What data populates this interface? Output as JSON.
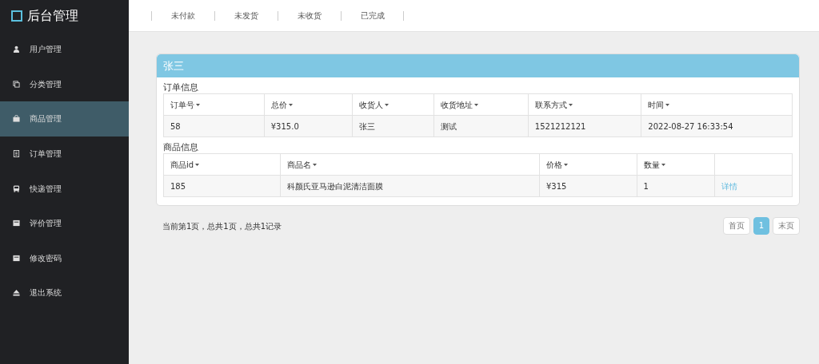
{
  "sidebar": {
    "title": "后台管理",
    "items": [
      {
        "label": "用户管理",
        "selected": false
      },
      {
        "label": "分类管理",
        "selected": false
      },
      {
        "label": "商品管理",
        "selected": true
      },
      {
        "label": "订单管理",
        "selected": false
      },
      {
        "label": "快递管理",
        "selected": false
      },
      {
        "label": "评价管理",
        "selected": false
      },
      {
        "label": "修改密码",
        "selected": false
      },
      {
        "label": "退出系统",
        "selected": false
      }
    ]
  },
  "tabs": [
    "未付款",
    "未发货",
    "未收货",
    "已完成"
  ],
  "panel": {
    "title": "张三",
    "order_section": "订单信息",
    "order_table": {
      "columns": [
        "订单号",
        "总价",
        "收货人",
        "收货地址",
        "联系方式",
        "时间"
      ],
      "rows": [
        [
          "58",
          "¥315.0",
          "张三",
          "测试",
          "1521212121",
          "2022-08-27 16:33:54"
        ]
      ]
    },
    "goods_section": "商品信息",
    "goods_table": {
      "columns": [
        "商品id",
        "商品名",
        "价格",
        "数量",
        ""
      ],
      "rows": [
        {
          "cells": [
            "185",
            "科颜氏亚马逊白泥清洁面膜",
            "¥315",
            "1"
          ],
          "action": "详情"
        }
      ]
    }
  },
  "pagination": {
    "summary": "当前第1页，总共1页，总共1记录",
    "buttons": [
      {
        "label": "首页",
        "selected": false
      },
      {
        "label": "1",
        "selected": true
      },
      {
        "label": "末页",
        "selected": false
      }
    ]
  }
}
